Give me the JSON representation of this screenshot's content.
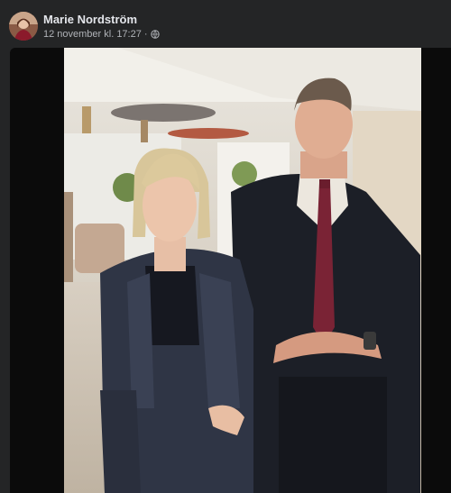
{
  "post": {
    "author": "Marie Nordström",
    "timestamp": "12 november kl. 17:27",
    "separator": "·",
    "privacy_icon": "globe-icon"
  },
  "photo": {
    "description_icon": "photo-image"
  },
  "colors": {
    "background": "#242526",
    "text_primary": "#e4e6eb",
    "text_secondary": "#b0b3b8",
    "photo_letterbox": "#0b0b0b"
  }
}
